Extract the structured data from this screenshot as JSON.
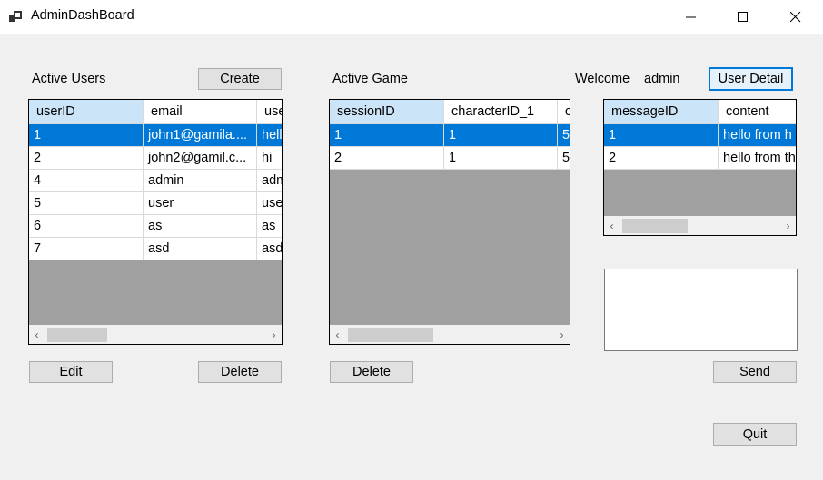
{
  "window": {
    "title": "AdminDashBoard",
    "minimize": "—",
    "maximize": "☐",
    "close": "✕"
  },
  "users_panel": {
    "label": "Active Users",
    "create": "Create",
    "edit": "Edit",
    "delete": "Delete",
    "columns": [
      "userID",
      "email",
      "use"
    ],
    "rows": [
      [
        "1",
        "john1@gamila....",
        "hell"
      ],
      [
        "2",
        "john2@gamil.c...",
        "hi"
      ],
      [
        "4",
        "admin",
        "adm"
      ],
      [
        "5",
        "user",
        "use"
      ],
      [
        "6",
        "as",
        "as"
      ],
      [
        "7",
        "asd",
        "asd"
      ]
    ]
  },
  "game_panel": {
    "label": "Active Game",
    "delete": "Delete",
    "columns": [
      "sessionID",
      "characterID_1",
      "c"
    ],
    "rows": [
      [
        "1",
        "1",
        "5"
      ],
      [
        "2",
        "1",
        "5"
      ]
    ]
  },
  "message_panel": {
    "welcome": "Welcome",
    "username": "admin",
    "user_detail": "User Detail",
    "columns": [
      "messageID",
      "content"
    ],
    "rows": [
      [
        "1",
        "hello from h"
      ],
      [
        "2",
        "hello from th"
      ]
    ],
    "send": "Send",
    "quit": "Quit",
    "message_input": ""
  },
  "icons": {
    "scroll_left": "chevron-left-icon",
    "scroll_right": "chevron-right-icon"
  }
}
